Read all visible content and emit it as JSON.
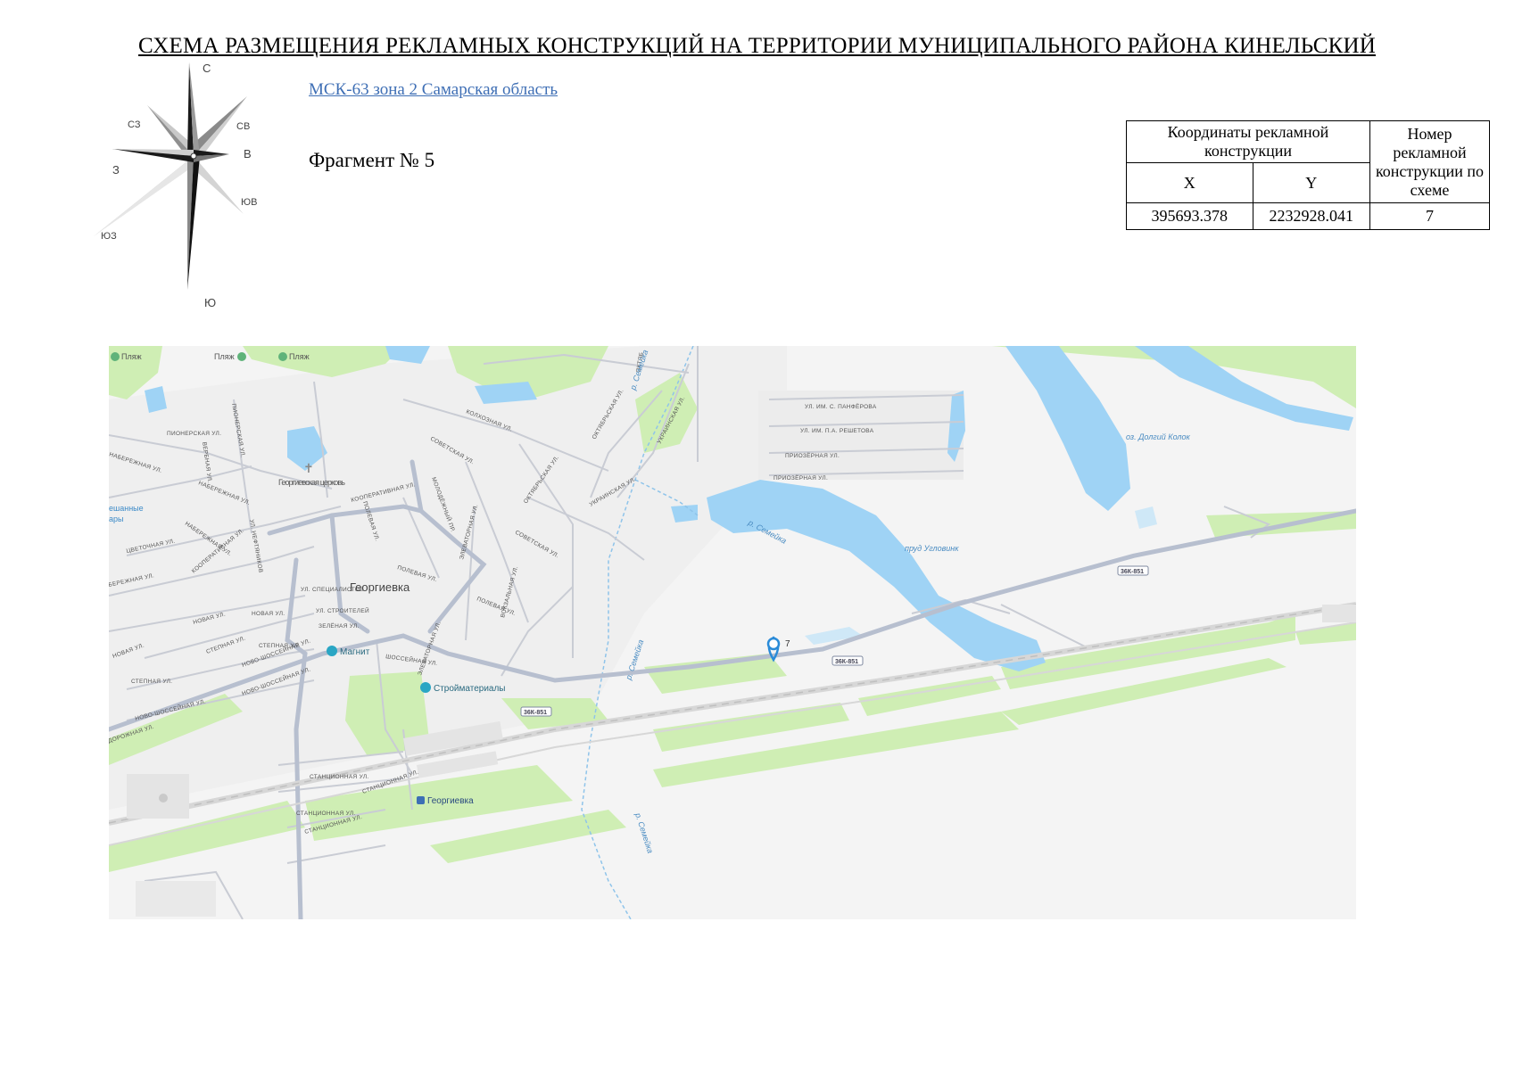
{
  "document": {
    "title": "СХЕМА РАЗМЕЩЕНИЯ РЕКЛАМНЫХ КОНСТРУКЦИЙ НА ТЕРРИТОРИИ МУНИЦИПАЛЬНОГО РАЙОНА КИНЕЛЬСКИЙ",
    "crs_link": "МСК-63 зона 2 Самарская область",
    "fragment": "Фрагмент № 5"
  },
  "compass": {
    "n": "С",
    "ne": "СВ",
    "e": "В",
    "se": "ЮВ",
    "s": "Ю",
    "sw": "ЮЗ",
    "w": "З",
    "nw": "СЗ"
  },
  "table": {
    "header_coords": "Координаты рекламной конструкции",
    "header_number": "Номер рекламной конструкции по схеме",
    "col_x": "X",
    "col_y": "Y",
    "rows": [
      {
        "x": "395693.378",
        "y": "2232928.041",
        "num": "7"
      }
    ]
  },
  "map": {
    "colors": {
      "water": "#9fd3f5",
      "green": "#cfeeb4",
      "road": "#b7bfcf",
      "land": "#f4f4f4",
      "marker": "#2a8bd8"
    },
    "marker_label": "7",
    "settlement": "Георгиевка",
    "pois": {
      "beach1": "Пляж",
      "beach2": "Пляж",
      "beach3": "Пляж",
      "church": "Георгиевская церковь",
      "magnit": "Магнит",
      "stroy": "Стройматериалы",
      "station": "Георгиевка",
      "mixed_a": "ешанные",
      "mixed_b": "ары"
    },
    "water_labels": {
      "lake": "оз. Долгий Колок",
      "pond": "пруд Угловинк"
    },
    "river": "р. Семейка",
    "road_shield": "36К-851",
    "streets": {
      "pionerskaya": "ПИОНЕРСКАЯ УЛ.",
      "pionerskaya_v": "ПИОНЕРСКАЯ УЛ.",
      "naberezhnaya1": "НАБЕРЕЖНАЯ УЛ.",
      "naberezhnaya2": "НАБЕРЕЖНАЯ УЛ.",
      "naberezhnaya3": "НАБЕРЕЖНАЯ УЛ.",
      "verbnaya": "ВЕРБНАЯ УЛ.",
      "kolhoznaya": "КОЛХОЗНАЯ УЛ.",
      "kooperativnaya": "КООПЕРАТИВНАЯ УЛ.",
      "kooperativnaya2": "КООПЕРАТИВНАЯ УЛ.",
      "sovetskaya": "СОВЕТСКАЯ УЛ.",
      "sovetskaya2": "СОВЕТСКАЯ УЛ.",
      "oktyabrskaya1": "ОКТЯБРЬСКАЯ УЛ.",
      "oktyabrskaya2": "ОКТЯБРЬСКАЯ УЛ.",
      "oktyabr_top": "ОКТЯБ",
      "ukrainskaya1": "УКРАИНСКАЯ УЛ.",
      "ukrainskaya2": "УКРАИНСКАЯ УЛ.",
      "molodezhny": "МОЛОДЁЖНЫЙ ПР.",
      "polevaya1": "ПОЛЕВАЯ УЛ.",
      "polevaya2": "ПОЛЕВАЯ УЛ.",
      "polevaya3": "ПОЛЕВАЯ УЛ.",
      "elevatornaya1": "ЭЛЕВАТОРНАЯ УЛ.",
      "elevatornaya2": "ЭЛЕВАТОРНАЯ УЛ.",
      "vokzalnaya": "ВОКЗАЛЬНАЯ УЛ.",
      "neftyanikov": "УЛ. НЕФТЯНИКОВ",
      "specialistov": "УЛ. СПЕЦИАЛИСТОВ",
      "stroiteley": "УЛ. СТРОИТЕЛЕЙ",
      "zelenaya": "ЗЕЛЁНАЯ УЛ.",
      "tsvetochnaya": "ЦВЕТОЧНАЯ УЛ.",
      "novaya1": "НОВАЯ УЛ.",
      "novaya2": "НОВАЯ УЛ.",
      "novaya3": "НОВАЯ УЛ.",
      "stepnaya1": "СТЕПНАЯ УЛ.",
      "stepnaya2": "СТЕПНАЯ УЛ.",
      "stepnaya3": "СТЕПНАЯ УЛ.",
      "novoshosse1": "НОВО-ШОССЕЙНАЯ УЛ.",
      "novoshosse2": "НОВО-ШОССЕЙНАЯ УЛ.",
      "novoshosse3": "НОВО-ШОССЕЙНАЯ УЛ.",
      "shosseynaya": "ШОССЕЙНАЯ УЛ.",
      "stancionnaya1": "СТАНЦИОННАЯ УЛ.",
      "stancionnaya2": "СТАНЦИОННАЯ УЛ.",
      "stancionnaya3": "СТАНЦИОННАЯ УЛ.",
      "stancionnaya4": "СТАНЦИОННАЯ УЛ.",
      "beregovaya": "БЕРЕЖНАЯ УЛ.",
      "dorozhnaya": "ДОРОЖНАЯ УЛ.",
      "panfilova": "УЛ. ИМ. С. ПАНФЁРОВА",
      "reshetova": "УЛ. ИМ. П.А. РЕШЕТОВА",
      "priozernaya1": "ПРИОЗЁРНАЯ УЛ.",
      "priozernaya2": "ПРИОЗЁРНАЯ УЛ."
    }
  }
}
